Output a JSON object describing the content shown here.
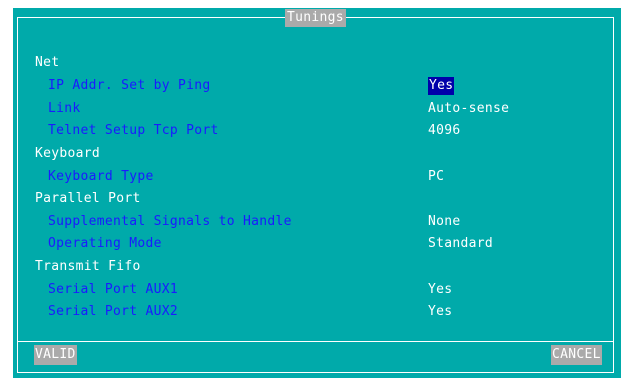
{
  "dialog": {
    "title": "Tunings"
  },
  "sections": {
    "net": {
      "label": "Net",
      "ip_addr_set_by_ping": {
        "label": "IP Addr. Set by Ping",
        "value": "Yes"
      },
      "link": {
        "label": "Link",
        "value": "Auto-sense"
      },
      "telnet_setup_tcp_port": {
        "label": "Telnet Setup Tcp Port",
        "value": "4096"
      }
    },
    "keyboard": {
      "label": "Keyboard",
      "keyboard_type": {
        "label": "Keyboard Type",
        "value": "PC"
      }
    },
    "parallel_port": {
      "label": "Parallel Port",
      "supplemental_signals": {
        "label": "Supplemental Signals to Handle",
        "value": "None"
      },
      "operating_mode": {
        "label": "Operating Mode",
        "value": "Standard"
      }
    },
    "transmit_fifo": {
      "label": "Transmit Fifo",
      "serial_port_aux1": {
        "label": "Serial Port AUX1",
        "value": "Yes"
      },
      "serial_port_aux2": {
        "label": "Serial Port AUX2",
        "value": "Yes"
      }
    }
  },
  "buttons": {
    "valid_label": "VALID",
    "cancel_label": "CANCEL"
  },
  "colors": {
    "background": "#00aaaa",
    "label_text": "#1a1aff",
    "value_text": "#ffffff",
    "selection": "#0000aa",
    "button_bg": "#aaaaaa"
  }
}
